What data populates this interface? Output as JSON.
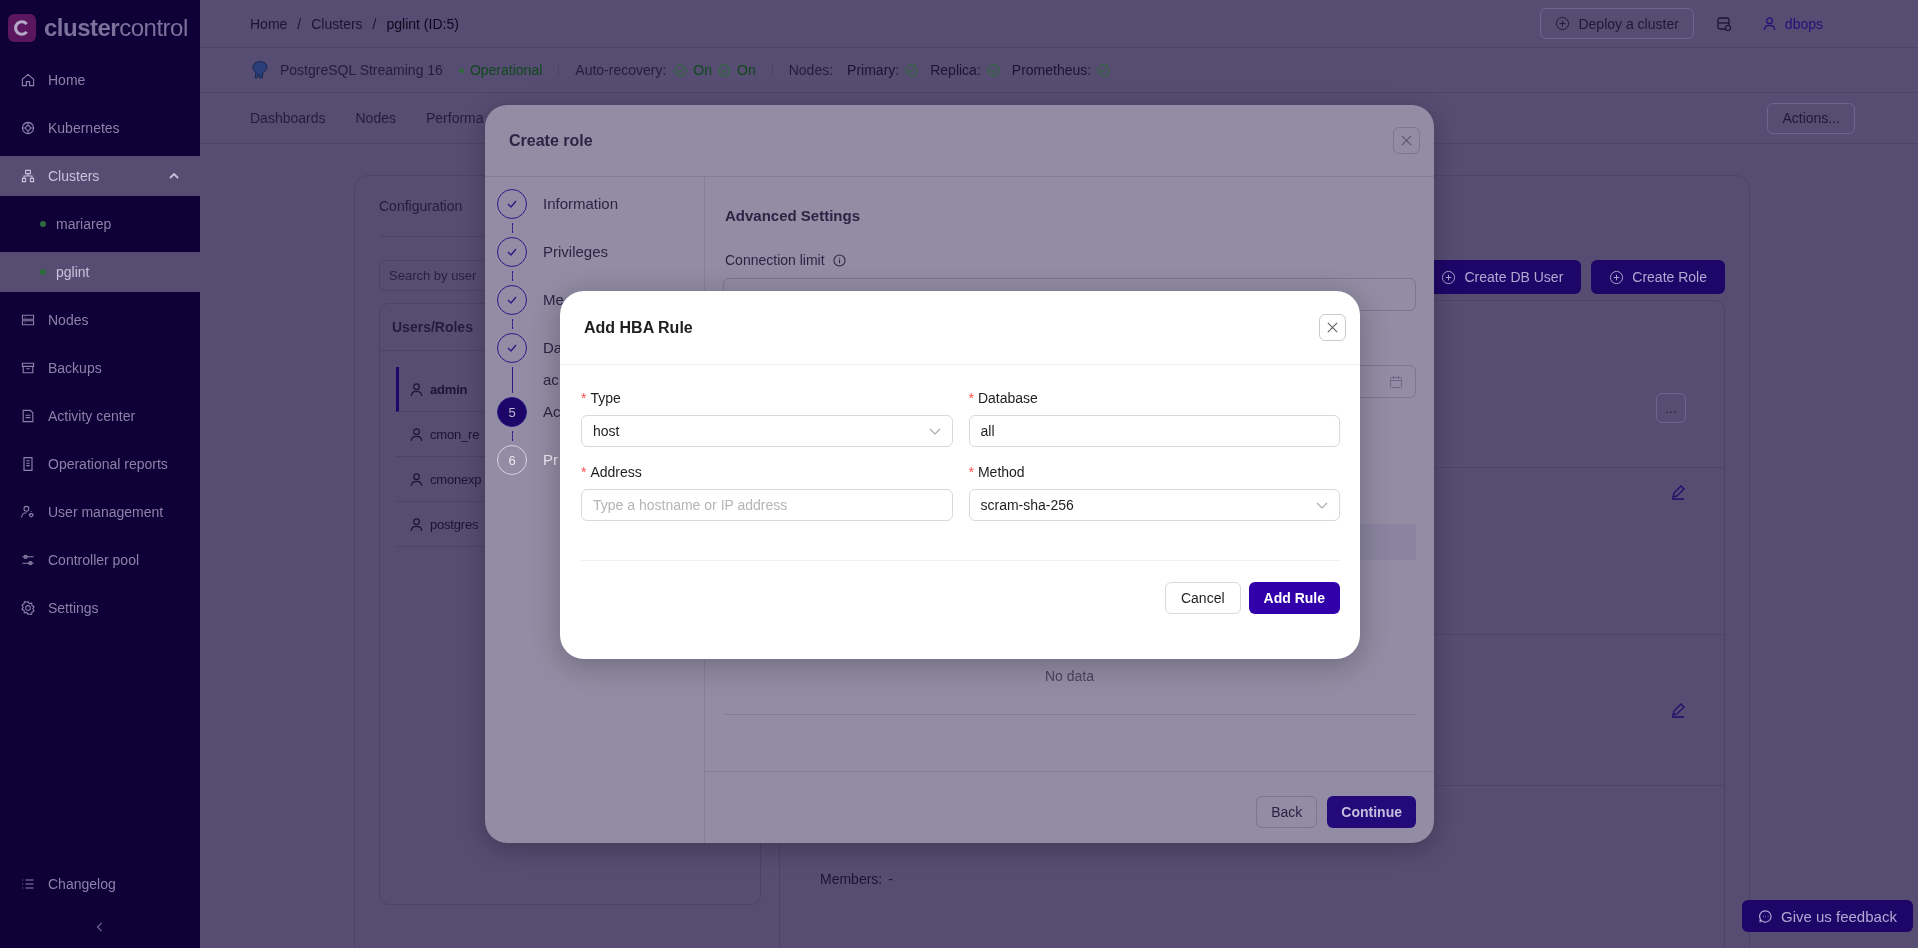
{
  "sidebar": {
    "logo": "**cluster**control",
    "items": [
      {
        "label": "Home",
        "selected": false
      },
      {
        "label": "Kubernetes",
        "selected": false
      },
      {
        "label": "Clusters",
        "selected": true,
        "expanded": true,
        "children": [
          {
            "label": "mariarep",
            "selected": false,
            "color": "#2f6a3c"
          },
          {
            "label": "pglint",
            "selected": true,
            "color": "#2f6a3c"
          }
        ]
      },
      {
        "label": "Nodes",
        "selected": false
      },
      {
        "label": "Backups",
        "selected": false
      },
      {
        "label": "Activity center",
        "selected": false
      },
      {
        "label": "Operational reports",
        "selected": false
      },
      {
        "label": "User management",
        "selected": false
      },
      {
        "label": "Controller pool",
        "selected": false
      },
      {
        "label": "Settings",
        "selected": false
      }
    ],
    "bottom": {
      "label": "Changelog"
    }
  },
  "header": {
    "separator": "/",
    "breadcrumb": [
      "Home",
      "Clusters",
      "pglint (ID:5)"
    ],
    "deploy_button": "Deploy a cluster",
    "user": "dbops"
  },
  "cluster_bar": {
    "name": "PostgreSQL Streaming 16",
    "status": "Operational",
    "auto_recovery_label": "Auto-recovery:",
    "auto_recovery": [
      "On",
      "On"
    ],
    "nodes_label": "Nodes:",
    "nodes": [
      "Primary:",
      "Replica:",
      "Prometheus:"
    ]
  },
  "tabs": {
    "items": [
      "Dashboards",
      "Nodes",
      "Performa"
    ],
    "actions_button": "Actions..."
  },
  "card": {
    "tab": "Configuration",
    "search": {
      "placeholder": "Search by user"
    },
    "table_heading": "Users/Roles",
    "rows": [
      {
        "name": "admin",
        "selected": true
      },
      {
        "name": "cmon_re",
        "selected": false
      },
      {
        "name": "cmonexp",
        "selected": false
      },
      {
        "name": "postgres",
        "selected": false
      }
    ],
    "buttons": [
      "Create DB User",
      "Create Role"
    ],
    "more_button": "...",
    "members_label": "Members:",
    "members_value": "-"
  },
  "create_role": {
    "title": "Create role",
    "steps": [
      {
        "lines": [
          "Information"
        ],
        "done": true,
        "active": false
      },
      {
        "lines": [
          "Privileges"
        ],
        "done": true,
        "active": false
      },
      {
        "lines": [
          "Me"
        ],
        "done": true,
        "active": false
      },
      {
        "lines": [
          "Da",
          "ac"
        ],
        "done": true,
        "active": false
      },
      {
        "lines": [
          "Ac"
        ],
        "done": false,
        "active": true,
        "number": "5"
      },
      {
        "lines": [
          "Pr"
        ],
        "done": false,
        "active": false,
        "number": "6"
      }
    ],
    "section_title": "Advanced Settings",
    "connection_limit_label": "Connection limit",
    "empty_text": "No data",
    "buttons": [
      "Back",
      "Continue"
    ]
  },
  "hba_dialog": {
    "title": "Add HBA Rule",
    "required_mark": "*",
    "fields": [
      {
        "label": "Type",
        "required": true,
        "kind": "select",
        "value": "host"
      },
      {
        "label": "Database",
        "required": true,
        "kind": "input",
        "value": "all"
      },
      {
        "label": "Address",
        "required": true,
        "kind": "input",
        "placeholder": "Type a hostname or IP address"
      },
      {
        "label": "Method",
        "required": true,
        "kind": "select",
        "value": "scram-sha-256"
      }
    ],
    "cancel_button": "Cancel",
    "submit_button": "Add Rule"
  },
  "feedback_button": "Give us feedback"
}
